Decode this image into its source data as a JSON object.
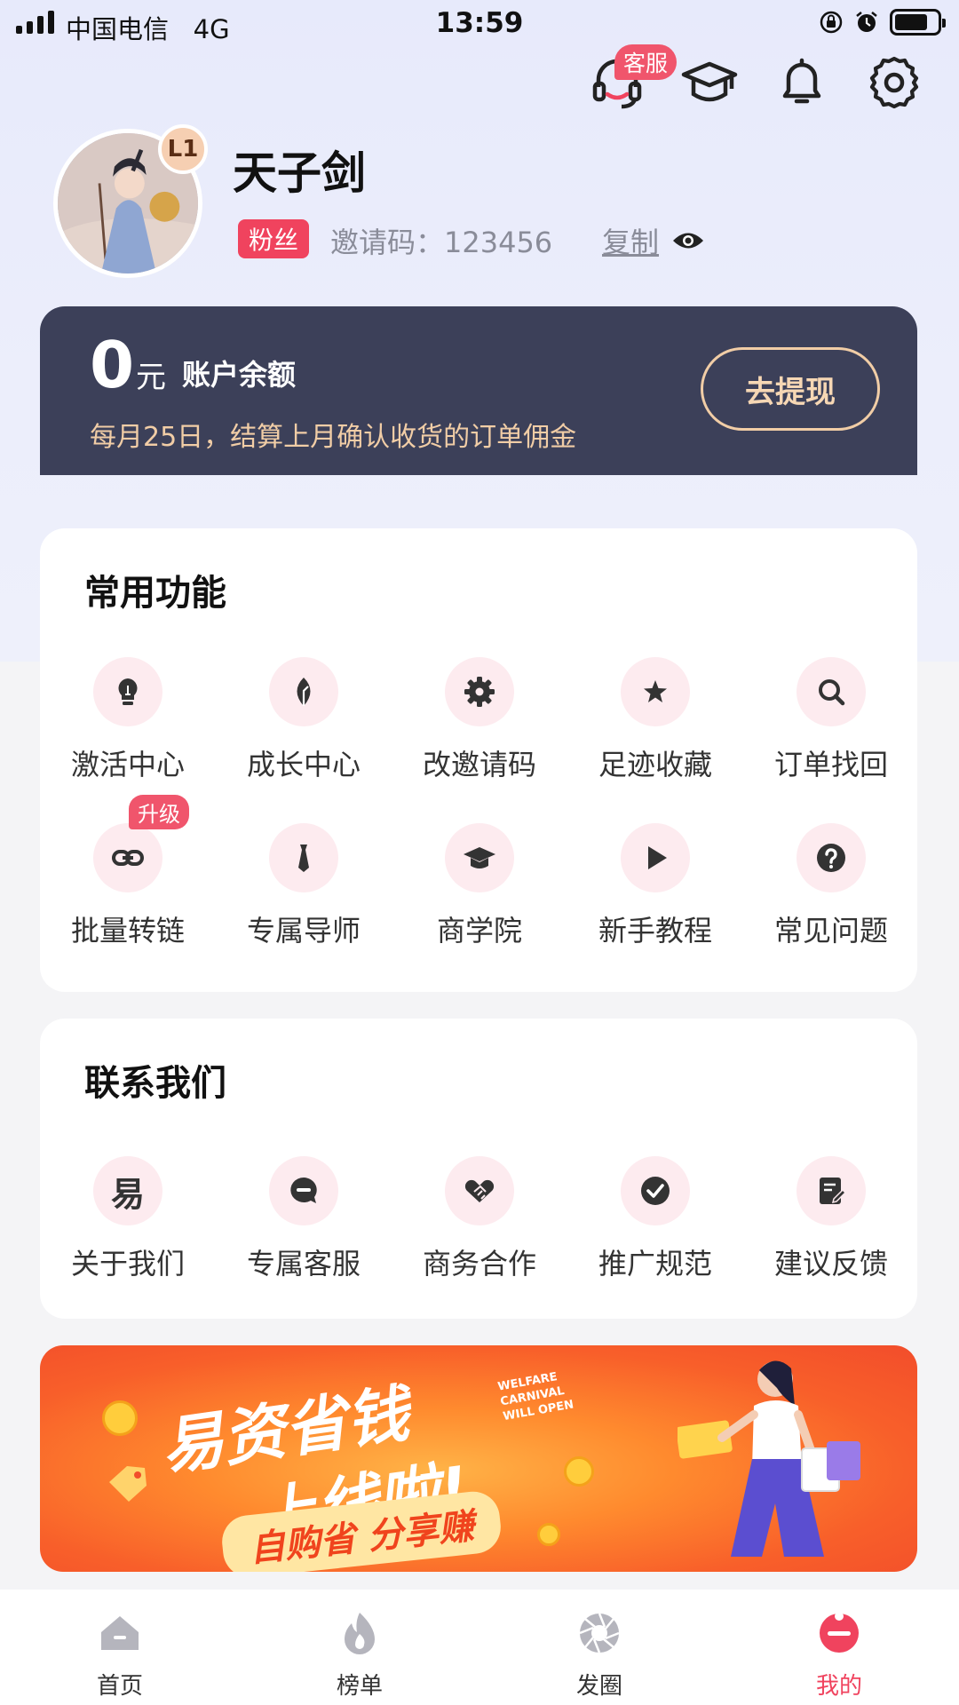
{
  "status_bar": {
    "carrier": "中国电信",
    "network": "4G",
    "time": "13:59"
  },
  "header": {
    "customer_service_badge": "客服"
  },
  "profile": {
    "username": "天子剑",
    "level": "L1",
    "tag": "粉丝",
    "invite_code": "邀请码：123456",
    "copy_label": "复制"
  },
  "balance": {
    "amount": "0",
    "unit": "元",
    "label": "账户余额",
    "note": "每月25日，结算上月确认收货的订单佣金",
    "withdraw_label": "去提现"
  },
  "common_functions": {
    "title": "常用功能",
    "items": [
      {
        "label": "激活中心",
        "icon": "lightbulb-icon"
      },
      {
        "label": "成长中心",
        "icon": "leaf-icon"
      },
      {
        "label": "改邀请码",
        "icon": "gear-icon"
      },
      {
        "label": "足迹收藏",
        "icon": "star-icon"
      },
      {
        "label": "订单找回",
        "icon": "search-icon"
      },
      {
        "label": "批量转链",
        "icon": "link-icon",
        "badge": "升级"
      },
      {
        "label": "专属导师",
        "icon": "tie-icon"
      },
      {
        "label": "商学院",
        "icon": "graduation-cap-icon"
      },
      {
        "label": "新手教程",
        "icon": "play-icon"
      },
      {
        "label": "常见问题",
        "icon": "question-icon"
      }
    ]
  },
  "contact_us": {
    "title": "联系我们",
    "items": [
      {
        "label": "关于我们",
        "icon": "yi-logo-icon",
        "glyph": "易"
      },
      {
        "label": "专属客服",
        "icon": "chat-icon"
      },
      {
        "label": "商务合作",
        "icon": "handshake-icon"
      },
      {
        "label": "推广规范",
        "icon": "check-circle-icon"
      },
      {
        "label": "建议反馈",
        "icon": "edit-note-icon"
      }
    ]
  },
  "banner": {
    "title_line1": "易资省钱",
    "title_line2": "上线啦!",
    "subtitle": "自购省 分享赚",
    "english_text": "WELFARE CARNIVAL WILL OPEN"
  },
  "tab_bar": {
    "items": [
      {
        "label": "首页",
        "icon": "home-icon"
      },
      {
        "label": "榜单",
        "icon": "flame-icon"
      },
      {
        "label": "发圈",
        "icon": "aperture-icon"
      },
      {
        "label": "我的",
        "icon": "profile-icon",
        "active": true
      }
    ]
  },
  "colors": {
    "accent": "#f0435e",
    "card_dark": "#3c4059",
    "gold": "#f1cda6",
    "icon_bg": "#fdebef"
  }
}
